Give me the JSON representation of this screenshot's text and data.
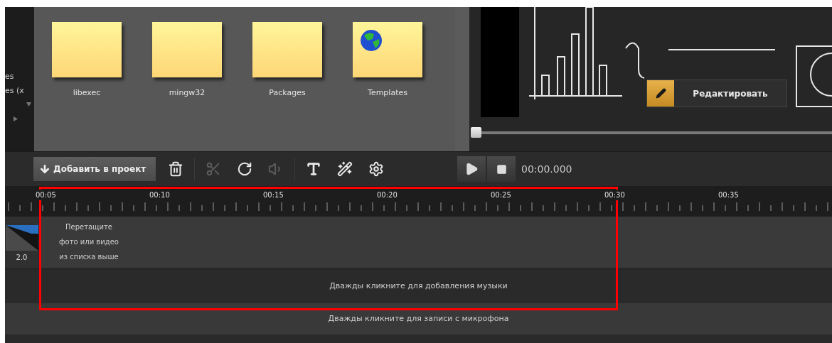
{
  "sidebar": {
    "items": [
      {
        "label": "es"
      },
      {
        "label": "es (x"
      }
    ]
  },
  "folders": [
    {
      "name": "libexec",
      "kind": "folder"
    },
    {
      "name": "mingw32",
      "kind": "folder"
    },
    {
      "name": "Packages",
      "kind": "folder"
    },
    {
      "name": "Templates",
      "kind": "web"
    }
  ],
  "preview": {
    "edit_button": "Редактировать",
    "slider": {
      "level": 0
    }
  },
  "toolbar": {
    "add_button": "Добавить в проект",
    "tool_groups": [
      {
        "tools": [
          {
            "kind": "delete",
            "disabled": false
          }
        ]
      },
      {
        "tools": [
          {
            "kind": "cut",
            "disabled": true
          },
          {
            "kind": "rotate",
            "disabled": false
          },
          {
            "kind": "volume",
            "disabled": true
          }
        ]
      },
      {
        "tools": [
          {
            "kind": "text",
            "disabled": false
          },
          {
            "kind": "effects",
            "disabled": false
          },
          {
            "kind": "settings",
            "disabled": false
          }
        ]
      }
    ]
  },
  "player": {
    "time": "00:00.000"
  },
  "timeline": {
    "ticks": [
      "00:05",
      "00:10",
      "00:15",
      "00:20",
      "00:25",
      "00:30",
      "00:35"
    ],
    "video_track": {
      "clip_duration": "2.0",
      "hint": [
        "Перетащите",
        "фото или видео",
        "из списка выше"
      ]
    },
    "music_track": {
      "hint": "Дважды кликните для добавления музыки"
    },
    "mic_track": {
      "hint": "Дважды кликните для записи с микрофона"
    }
  },
  "highlight_frame": true
}
